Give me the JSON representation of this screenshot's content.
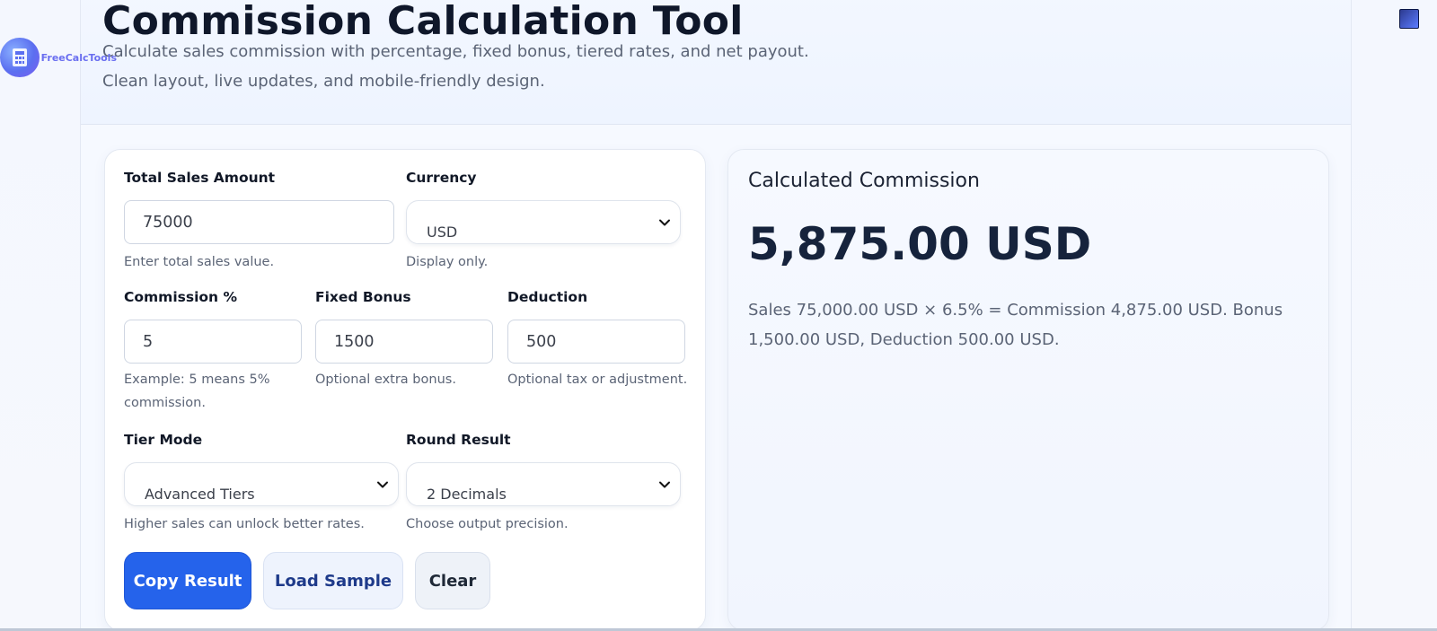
{
  "header": {
    "title": "Commission Calculation Tool",
    "subtitle_line1": "Calculate sales commission with percentage, fixed bonus, tiered rates, and net payout.",
    "subtitle_line2": "Clean layout, live updates, and mobile-friendly design."
  },
  "logo": {
    "text": "FreeCalcTools",
    "icon": "calculator-icon"
  },
  "form": {
    "total_sales": {
      "label": "Total Sales Amount",
      "value": "75000",
      "hint": "Enter total sales value."
    },
    "currency": {
      "label": "Currency",
      "value": "USD",
      "hint": "Display only."
    },
    "commission": {
      "label": "Commission %",
      "value": "5",
      "hint": "Example: 5 means 5% commission."
    },
    "fixed_bonus": {
      "label": "Fixed Bonus",
      "value": "1500",
      "hint": "Optional extra bonus."
    },
    "deduction": {
      "label": "Deduction",
      "value": "500",
      "hint": "Optional tax or adjustment."
    },
    "tier_mode": {
      "label": "Tier Mode",
      "value": "Advanced Tiers",
      "hint": "Higher sales can unlock better rates."
    },
    "round_result": {
      "label": "Round Result",
      "value": "2 Decimals",
      "hint": "Choose output precision."
    }
  },
  "buttons": {
    "copy": "Copy Result",
    "load": "Load Sample",
    "clear": "Clear"
  },
  "result": {
    "title": "Calculated Commission",
    "value": "5,875.00 USD",
    "detail": "Sales 75,000.00 USD × 6.5% = Commission 4,875.00 USD. Bonus 1,500.00 USD, Deduction 500.00 USD."
  },
  "colors": {
    "primary": "#2563eb",
    "background": "#f3f6fd",
    "text_dark": "#0f172a",
    "text_muted": "#5b6476"
  }
}
